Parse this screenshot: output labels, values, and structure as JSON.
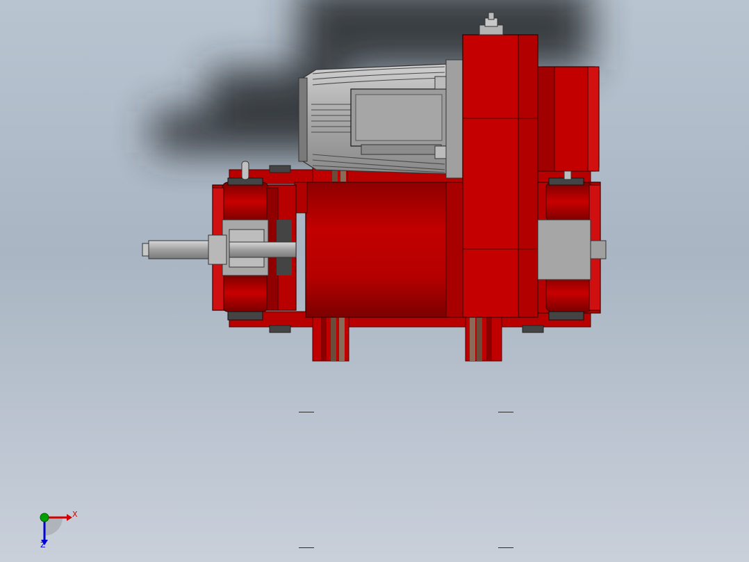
{
  "viewport": {
    "background_top": "#b8c4d0",
    "background_bottom": "#c9d0da"
  },
  "model": {
    "parts": [
      {
        "name": "motor-housing",
        "color": "#9c9c9c"
      },
      {
        "name": "gearbox",
        "color": "#c40000"
      },
      {
        "name": "drum",
        "color": "#b00000"
      },
      {
        "name": "end-carriage-left",
        "color": "#b80000"
      },
      {
        "name": "end-carriage-right",
        "color": "#b80000"
      },
      {
        "name": "shaft",
        "color": "#a8a8a8"
      }
    ],
    "colors": {
      "red": "#c00000",
      "dark_red": "#7a0000",
      "grey": "#a6a6a6",
      "dark_grey": "#555555",
      "shadow": "#2a2d33"
    }
  },
  "triad": {
    "x_label": "X",
    "z_label": "Z",
    "x_color": "#d40000",
    "y_color": "#00a000",
    "z_color": "#0000d0"
  }
}
